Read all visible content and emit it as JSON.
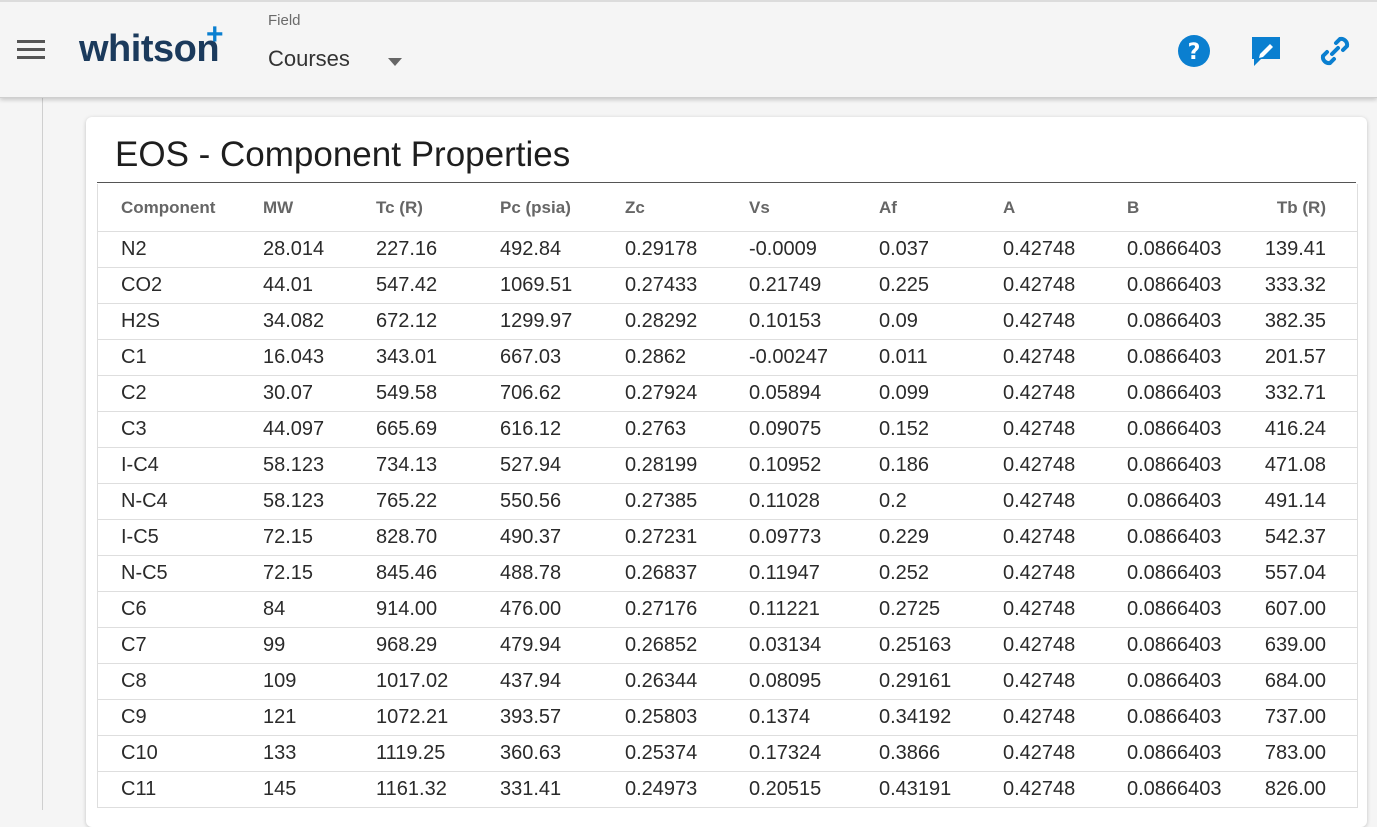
{
  "app": {
    "logo_text": "whitson",
    "logo_plus": "+"
  },
  "header": {
    "field_label": "Field",
    "field_value": "Courses",
    "icons": [
      "menu-icon",
      "help-icon",
      "feedback-icon",
      "link-icon"
    ]
  },
  "colors": {
    "brand_dark": "#1b3a5c",
    "accent_blue": "#0a7fd0"
  },
  "page": {
    "title": "EOS - Component Properties"
  },
  "table": {
    "columns": [
      "Component",
      "MW",
      "Tc (R)",
      "Pc (psia)",
      "Zc",
      "Vs",
      "Af",
      "A",
      "B",
      "Tb (R)"
    ],
    "rows": [
      [
        "N2",
        "28.014",
        "227.16",
        "492.84",
        "0.29178",
        "-0.0009",
        "0.037",
        "0.42748",
        "0.0866403",
        "139.41"
      ],
      [
        "CO2",
        "44.01",
        "547.42",
        "1069.51",
        "0.27433",
        "0.21749",
        "0.225",
        "0.42748",
        "0.0866403",
        "333.32"
      ],
      [
        "H2S",
        "34.082",
        "672.12",
        "1299.97",
        "0.28292",
        "0.10153",
        "0.09",
        "0.42748",
        "0.0866403",
        "382.35"
      ],
      [
        "C1",
        "16.043",
        "343.01",
        "667.03",
        "0.2862",
        "-0.00247",
        "0.011",
        "0.42748",
        "0.0866403",
        "201.57"
      ],
      [
        "C2",
        "30.07",
        "549.58",
        "706.62",
        "0.27924",
        "0.05894",
        "0.099",
        "0.42748",
        "0.0866403",
        "332.71"
      ],
      [
        "C3",
        "44.097",
        "665.69",
        "616.12",
        "0.2763",
        "0.09075",
        "0.152",
        "0.42748",
        "0.0866403",
        "416.24"
      ],
      [
        "I-C4",
        "58.123",
        "734.13",
        "527.94",
        "0.28199",
        "0.10952",
        "0.186",
        "0.42748",
        "0.0866403",
        "471.08"
      ],
      [
        "N-C4",
        "58.123",
        "765.22",
        "550.56",
        "0.27385",
        "0.11028",
        "0.2",
        "0.42748",
        "0.0866403",
        "491.14"
      ],
      [
        "I-C5",
        "72.15",
        "828.70",
        "490.37",
        "0.27231",
        "0.09773",
        "0.229",
        "0.42748",
        "0.0866403",
        "542.37"
      ],
      [
        "N-C5",
        "72.15",
        "845.46",
        "488.78",
        "0.26837",
        "0.11947",
        "0.252",
        "0.42748",
        "0.0866403",
        "557.04"
      ],
      [
        "C6",
        "84",
        "914.00",
        "476.00",
        "0.27176",
        "0.11221",
        "0.2725",
        "0.42748",
        "0.0866403",
        "607.00"
      ],
      [
        "C7",
        "99",
        "968.29",
        "479.94",
        "0.26852",
        "0.03134",
        "0.25163",
        "0.42748",
        "0.0866403",
        "639.00"
      ],
      [
        "C8",
        "109",
        "1017.02",
        "437.94",
        "0.26344",
        "0.08095",
        "0.29161",
        "0.42748",
        "0.0866403",
        "684.00"
      ],
      [
        "C9",
        "121",
        "1072.21",
        "393.57",
        "0.25803",
        "0.1374",
        "0.34192",
        "0.42748",
        "0.0866403",
        "737.00"
      ],
      [
        "C10",
        "133",
        "1119.25",
        "360.63",
        "0.25374",
        "0.17324",
        "0.3866",
        "0.42748",
        "0.0866403",
        "783.00"
      ],
      [
        "C11",
        "145",
        "1161.32",
        "331.41",
        "0.24973",
        "0.20515",
        "0.43191",
        "0.42748",
        "0.0866403",
        "826.00"
      ]
    ]
  }
}
